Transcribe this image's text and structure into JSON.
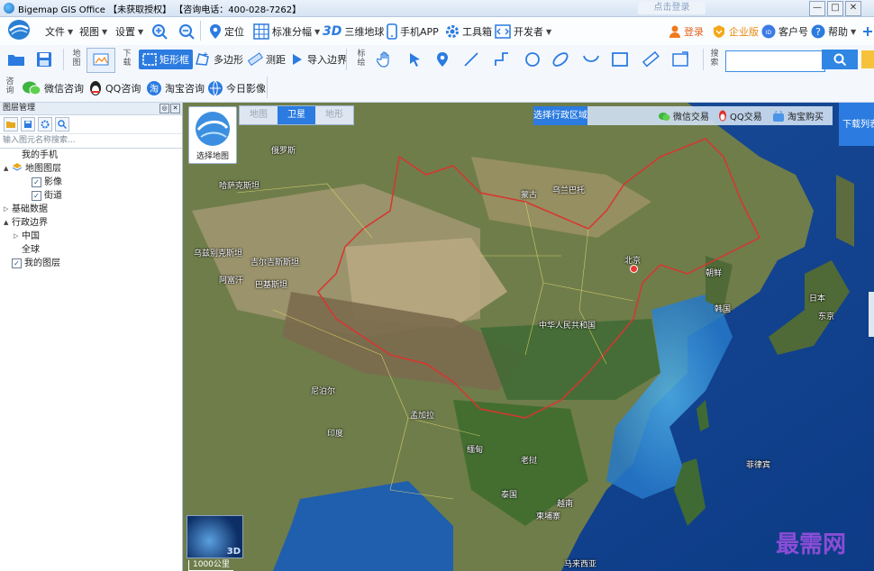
{
  "title_bar": {
    "title": "Bigemap GIS Office 【未获取授权】 【咨询电话：400-028-7262】",
    "login_field": "点击登录",
    "buttons": {
      "minimize": "—",
      "maximize": "□",
      "close": "✕"
    }
  },
  "menu": {
    "file": "文件",
    "view": "视图",
    "settings": "设置",
    "locate": "定位",
    "standard_sheet": "标准分幅",
    "three_d_label": "3D",
    "three_d_globe": "三维地球",
    "mobile_app": "手机APP",
    "toolbox": "工具箱",
    "developer": "开发者",
    "login": "登录",
    "enterprise": "企业版",
    "customer_id": "客户号",
    "help": "帮助"
  },
  "toolbar": {
    "group_map": "地图",
    "group_download": "下载",
    "rectangle": "矩形框",
    "polygon": "多边形",
    "measure": "测距",
    "import_border": "导入边界",
    "group_draw": "标绘",
    "group_search": "搜索",
    "search_placeholder": ""
  },
  "consult": {
    "group_label": "咨询",
    "wechat": "微信咨询",
    "qq": "QQ咨询",
    "taobao": "淘宝咨询",
    "today_image": "今日影像"
  },
  "layer_panel": {
    "title": "图层管理",
    "search_placeholder": "输入图元名称搜索...",
    "tree": [
      {
        "label": "我的手机",
        "level": 1,
        "checkbox": false,
        "expander": ""
      },
      {
        "label": "地图图层",
        "level": 0,
        "checkbox": false,
        "expander": "▲"
      },
      {
        "label": "影像",
        "level": 2,
        "checkbox": true,
        "expander": ""
      },
      {
        "label": "街道",
        "level": 2,
        "checkbox": true,
        "expander": ""
      },
      {
        "label": "基础数据",
        "level": 0,
        "checkbox": false,
        "expander": "▷"
      },
      {
        "label": "行政边界",
        "level": 0,
        "checkbox": false,
        "expander": "▲"
      },
      {
        "label": "中国",
        "level": 1,
        "checkbox": false,
        "expander": "▷"
      },
      {
        "label": "全球",
        "level": 1,
        "checkbox": false,
        "expander": ""
      },
      {
        "label": "我的图层",
        "level": 0,
        "checkbox": true,
        "expander": ""
      }
    ]
  },
  "map": {
    "select_map": "选择地图",
    "tabs": [
      "地图",
      "卫星",
      "地形"
    ],
    "active_tab": 1,
    "select_region": "选择行政区域",
    "wechat_trade": "微信交易",
    "qq_trade": "QQ交易",
    "taobao_buy": "淘宝购买",
    "download_list": "下载列表",
    "minimap_label": "3D",
    "scale": "1000公里",
    "watermark": "最需网",
    "place_labels": {
      "mongolia": "蒙古",
      "china": "中华人民共和国",
      "beijing": "北京",
      "india": "印度",
      "japan": "日本",
      "korea": "韩国",
      "north_korea": "朝鲜",
      "myanmar": "缅甸",
      "thailand": "泰国",
      "vietnam": "越南",
      "philippines": "菲律宾",
      "tokyo": "东京",
      "kazakhstan": "哈萨克斯坦",
      "mongolia_capital": "乌兰巴托",
      "pakistan": "巴基斯坦",
      "nepal": "尼泊尔",
      "bangladesh": "孟加拉",
      "malaysia": "马来西亚",
      "cambodia": "柬埔寨",
      "laos": "老挝",
      "afghanistan": "阿富汗",
      "russia": "俄罗斯",
      "uzbekistan": "乌兹别克斯坦",
      "kyrgyzstan": "吉尔吉斯斯坦"
    }
  },
  "colors": {
    "accent": "#2b7be0",
    "border_red": "#d8352f",
    "ocean": "#1e5fb0",
    "land": "#7b8a55"
  }
}
